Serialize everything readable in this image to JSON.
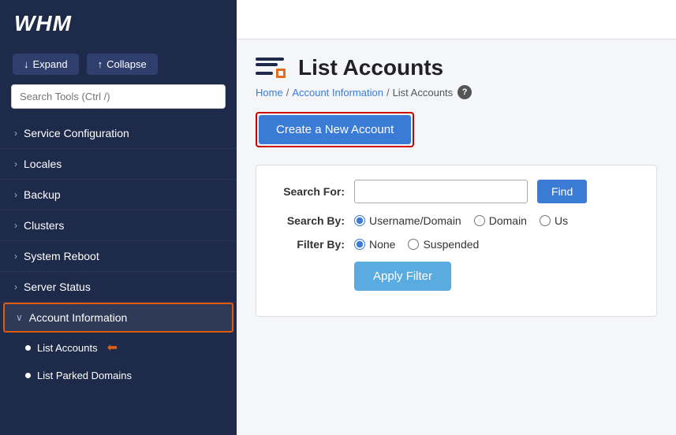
{
  "sidebar": {
    "logo": "WHM",
    "expand_label": "Expand",
    "collapse_label": "Collapse",
    "search_placeholder": "Search Tools (Ctrl /)",
    "search_highlight": "Search",
    "search_rest": " Tools (Ctrl /)",
    "nav_items": [
      {
        "id": "service-configuration",
        "label": "Service Configuration",
        "expanded": false
      },
      {
        "id": "locales",
        "label": "Locales",
        "expanded": false
      },
      {
        "id": "backup",
        "label": "Backup",
        "expanded": false
      },
      {
        "id": "clusters",
        "label": "Clusters",
        "expanded": false
      },
      {
        "id": "system-reboot",
        "label": "System Reboot",
        "expanded": false
      },
      {
        "id": "server-status",
        "label": "Server Status",
        "expanded": false
      },
      {
        "id": "account-information",
        "label": "Account Information",
        "expanded": true
      }
    ],
    "sub_items": [
      {
        "id": "list-accounts",
        "label": "List Accounts",
        "current": true
      },
      {
        "id": "list-parked-domains",
        "label": "List Parked Domains",
        "current": false
      }
    ]
  },
  "main": {
    "page_title": "List Accounts",
    "breadcrumb": {
      "home": "Home",
      "account_information": "Account Information",
      "current": "List Accounts"
    },
    "create_account_btn": "Create a New Account",
    "search_section": {
      "search_for_label": "Search For:",
      "search_by_label": "Search By:",
      "filter_by_label": "Filter By:",
      "find_btn": "Find",
      "apply_filter_btn": "Apply Filter",
      "search_by_options": [
        "Username/Domain",
        "Domain",
        "Us"
      ],
      "filter_by_options": [
        "None",
        "Suspended"
      ]
    }
  }
}
